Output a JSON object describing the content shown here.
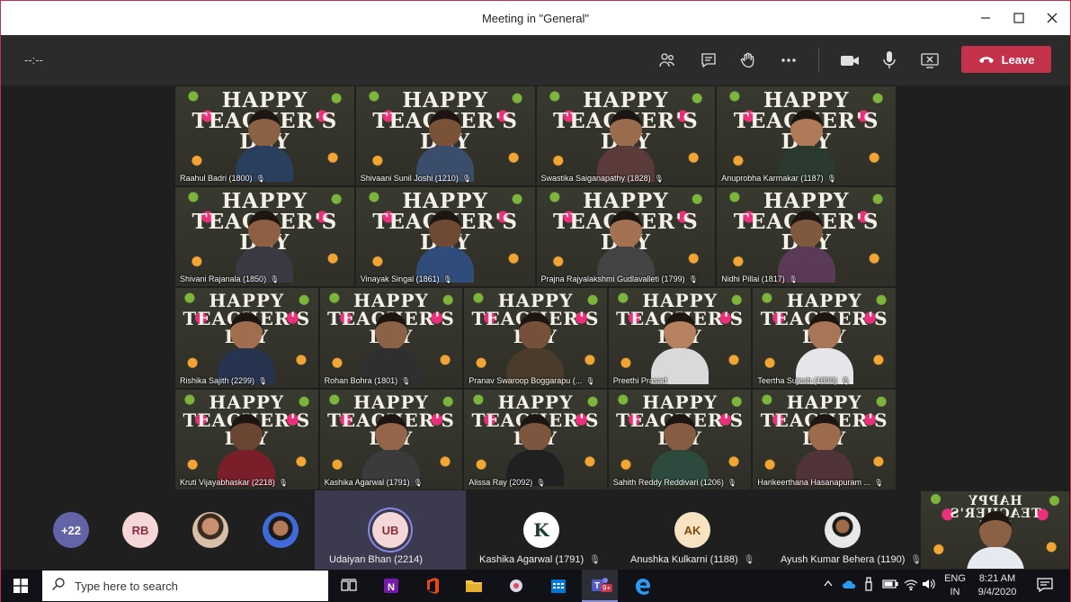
{
  "window": {
    "title": "Meeting in \"General\"",
    "minimize_icon": "minimize-icon",
    "maximize_icon": "maximize-icon",
    "close_icon": "close-icon"
  },
  "toolbar": {
    "timer": "--:--",
    "leave_label": "Leave",
    "leave_color": "#c4314b"
  },
  "grid": {
    "banner_line1": "HAPPY",
    "banner_line2": "TEACHER'S",
    "banner_line3": "DAY",
    "tiles": [
      {
        "name": "Raahul Badri (1800)"
      },
      {
        "name": "Shivaani Sunil Joshi (1210)"
      },
      {
        "name": "Swastika Saiganapathy (1828)"
      },
      {
        "name": "Anuprobha Karmakar (1187)"
      },
      {
        "name": "Shivani Rajanala (1850)"
      },
      {
        "name": "Vinayak Singal (1861)"
      },
      {
        "name": "Prajna Rajyalakshmi Gudlavalleti (1799)"
      },
      {
        "name": "Nidhi Pillai (1817)"
      },
      {
        "name": "Rishika Sajith (2299)"
      },
      {
        "name": "Rohan Bohra (1801)"
      },
      {
        "name": "Pranav Swaroop Boggarapu (..."
      },
      {
        "name": "Preethi Prasad"
      },
      {
        "name": "Teertha Sujesh (1830)"
      },
      {
        "name": "Kruti Vijayabhaskar (2218)"
      },
      {
        "name": "Kashika Agarwal (1791)"
      },
      {
        "name": "Alissa Ray (2092)"
      },
      {
        "name": "Sahith Reddy Reddivari (1206)"
      },
      {
        "name": "Harikeerthana Hasanapuram ..."
      }
    ]
  },
  "strip": {
    "overflow_count": "+22",
    "rb_initials": "RB",
    "participants": [
      {
        "initials": "UB",
        "name": "Udaiyan Bhan (2214)"
      },
      {
        "initials": "K",
        "name": "Kashika Agarwal (1791)"
      },
      {
        "initials": "AK",
        "name": "Anushka Kulkarni (1188)"
      },
      {
        "initials": "",
        "name": "Ayush Kumar Behera (1190)"
      }
    ]
  },
  "taskbar": {
    "search_placeholder": "Type here to search",
    "teams_badge": "9+",
    "lang_line1": "ENG",
    "lang_line2": "IN",
    "time": "8:21 AM",
    "date": "9/4/2020"
  }
}
